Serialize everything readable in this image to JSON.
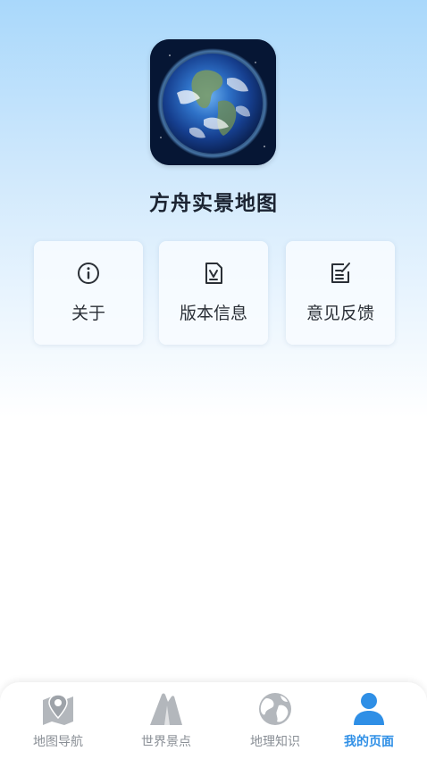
{
  "app": {
    "name": "方舟实景地图",
    "icon": "earth-globe-icon"
  },
  "cards": [
    {
      "label": "关于",
      "icon": "info-icon"
    },
    {
      "label": "版本信息",
      "icon": "version-document-icon"
    },
    {
      "label": "意见反馈",
      "icon": "feedback-edit-icon"
    }
  ],
  "tabbar": {
    "items": [
      {
        "label": "地图导航",
        "icon": "map-pin-icon",
        "active": false
      },
      {
        "label": "世界景点",
        "icon": "mountain-icon",
        "active": false
      },
      {
        "label": "地理知识",
        "icon": "globe-icon",
        "active": false
      },
      {
        "label": "我的页面",
        "icon": "user-icon",
        "active": true
      }
    ],
    "colors": {
      "inactive": "#b3b7bc",
      "active": "#2f8fe6"
    }
  }
}
